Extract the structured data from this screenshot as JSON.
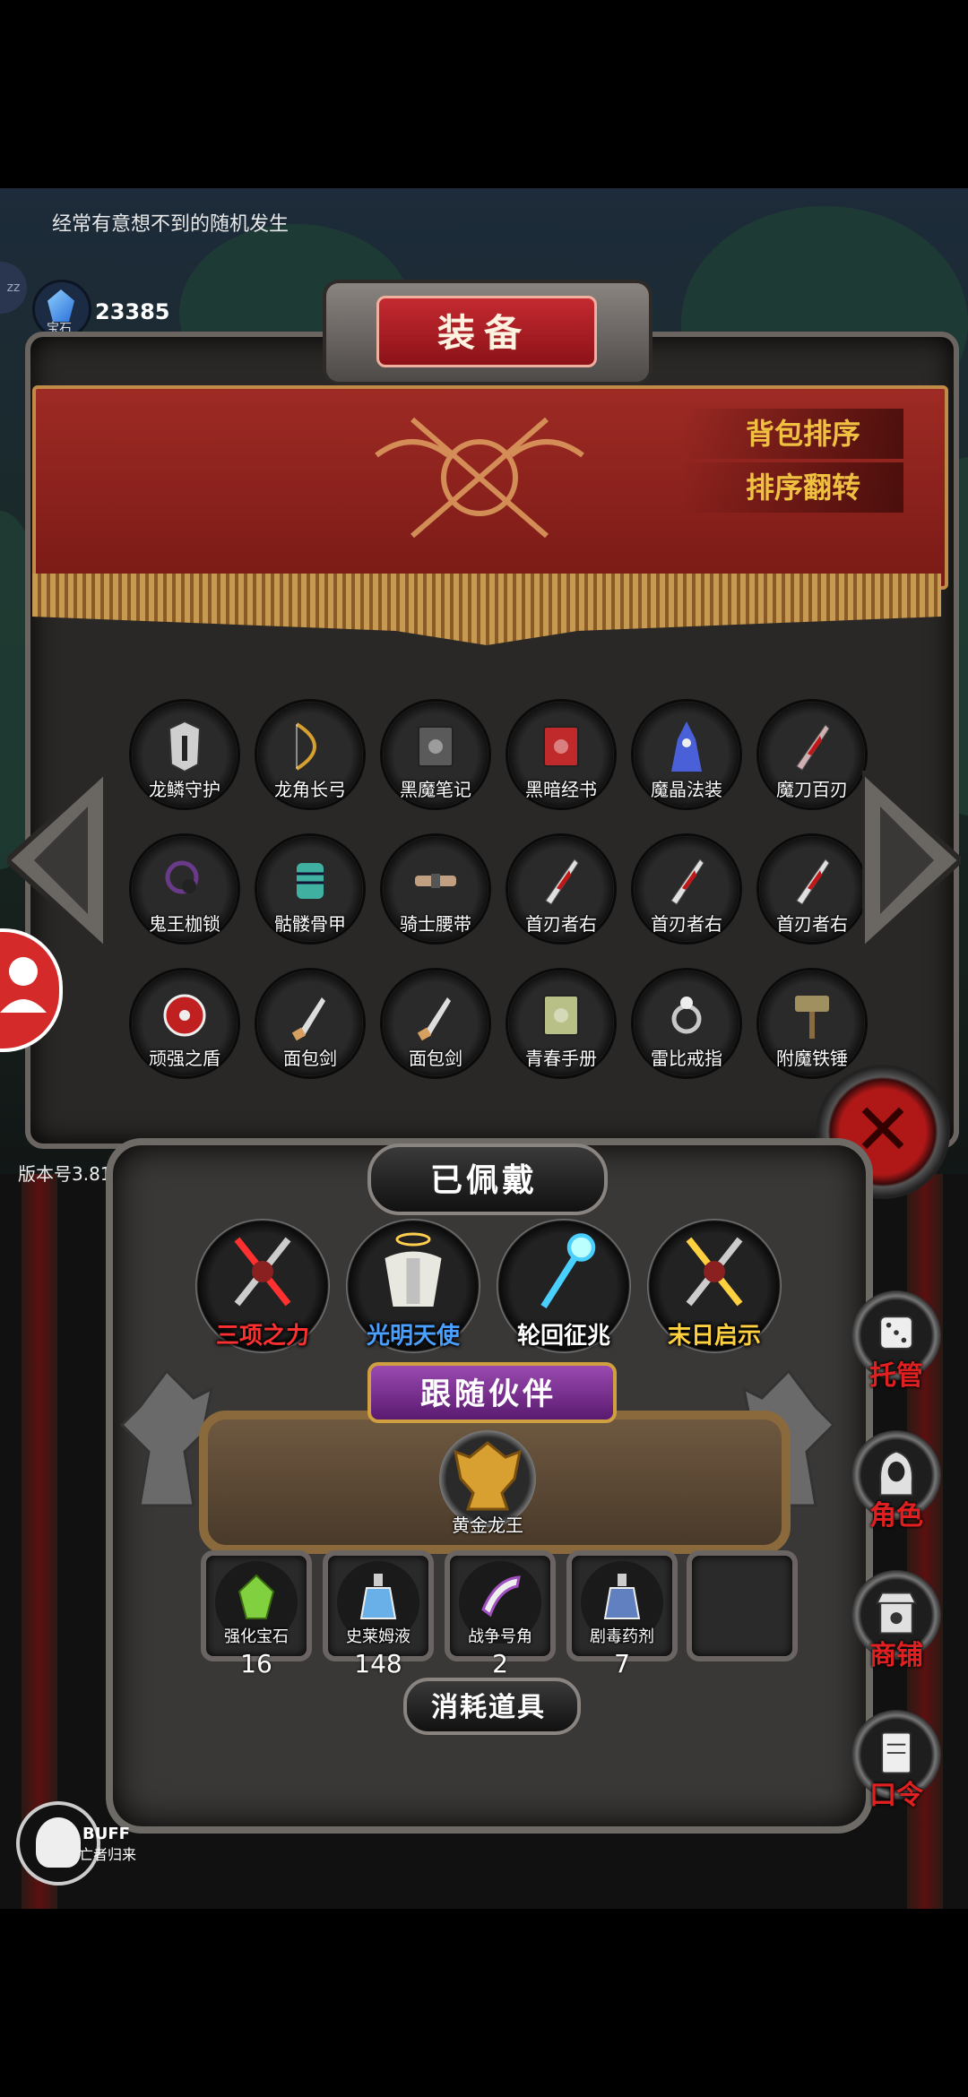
{
  "hint": "经常有意想不到的随机发生",
  "currency": {
    "label": "宝石",
    "value": "23385",
    "side_tab": "zz"
  },
  "title": "装备",
  "banner_buttons": {
    "sort": "背包排序",
    "reverse": "排序翻转"
  },
  "inventory": [
    {
      "name": "龙鳞守护",
      "icon": "helmet-icon",
      "color": "#cfcfcf"
    },
    {
      "name": "龙角长弓",
      "icon": "bow-icon",
      "color": "#d8a030"
    },
    {
      "name": "黑魔笔记",
      "icon": "dark-book-icon",
      "color": "#5a5a5a"
    },
    {
      "name": "黑暗经书",
      "icon": "red-book-icon",
      "color": "#c02a2a"
    },
    {
      "name": "魔晶法装",
      "icon": "wizard-robe-icon",
      "color": "#4a60d8"
    },
    {
      "name": "魔刀百刃",
      "icon": "serrated-blade-icon",
      "color": "#d0b0b0"
    },
    {
      "name": "鬼王枷锁",
      "icon": "chain-icon",
      "color": "#6a3a8a"
    },
    {
      "name": "骷髅骨甲",
      "icon": "skeleton-armor-icon",
      "color": "#40b0a0"
    },
    {
      "name": "骑士腰带",
      "icon": "belt-icon",
      "color": "#c0a080"
    },
    {
      "name": "首刃者右",
      "icon": "blood-blade-icon",
      "color": "#e0e0e0"
    },
    {
      "name": "首刃者右",
      "icon": "blood-blade-icon",
      "color": "#e0e0e0"
    },
    {
      "name": "首刃者右",
      "icon": "blood-blade-icon",
      "color": "#e0e0e0"
    },
    {
      "name": "顽强之盾",
      "icon": "round-shield-icon",
      "color": "#c02020"
    },
    {
      "name": "面包剑",
      "icon": "dagger-icon",
      "color": "#d8a060"
    },
    {
      "name": "面包剑",
      "icon": "dagger-icon",
      "color": "#d8a060"
    },
    {
      "name": "青春手册",
      "icon": "manual-icon",
      "color": "#b8c088"
    },
    {
      "name": "雷比戒指",
      "icon": "ring-icon",
      "color": "#c8c8c8"
    },
    {
      "name": "附魔铁锤",
      "icon": "hammer-icon",
      "color": "#a09060"
    }
  ],
  "version": "版本号3.81",
  "equipped": {
    "title": "已佩戴",
    "items": [
      {
        "name": "三项之力",
        "icon": "trinity-weapon-icon",
        "color": "#ff3030"
      },
      {
        "name": "光明天使",
        "icon": "angel-armor-icon",
        "color": "#4aa0ff"
      },
      {
        "name": "轮回征兆",
        "icon": "ice-staff-icon",
        "color": "#ffffff"
      },
      {
        "name": "末日启示",
        "icon": "doom-axe-icon",
        "color": "#ffd040"
      }
    ]
  },
  "companion": {
    "title": "跟随伙伴",
    "name": "黄金龙王",
    "icon": "golden-dragon-icon"
  },
  "consumables": {
    "title": "消耗道具",
    "items": [
      {
        "name": "强化宝石",
        "count": "16",
        "icon": "green-gem-icon",
        "color": "#80d040"
      },
      {
        "name": "史莱姆液",
        "count": "148",
        "icon": "potion-bottle-icon",
        "color": "#6ab0e8"
      },
      {
        "name": "战争号角",
        "count": "2",
        "icon": "war-horn-icon",
        "color": "#a050c0"
      },
      {
        "name": "剧毒药剂",
        "count": "7",
        "icon": "poison-flask-icon",
        "color": "#6080c0"
      }
    ]
  },
  "side_menu": [
    {
      "label": "托管",
      "icon": "dice-icon"
    },
    {
      "label": "角色",
      "icon": "hooded-figure-icon"
    },
    {
      "label": "商铺",
      "icon": "shop-icon"
    },
    {
      "label": "口令",
      "icon": "scroll-icon"
    }
  ],
  "buff": {
    "label": "BUFF",
    "sub": "亡者归来"
  },
  "close_glyph": "✕"
}
